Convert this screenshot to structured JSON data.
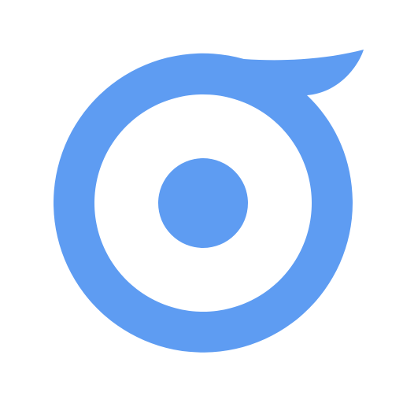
{
  "logo": {
    "name": "blue-ring-logo",
    "color": "#5e9cf2",
    "background": "#ffffff"
  }
}
